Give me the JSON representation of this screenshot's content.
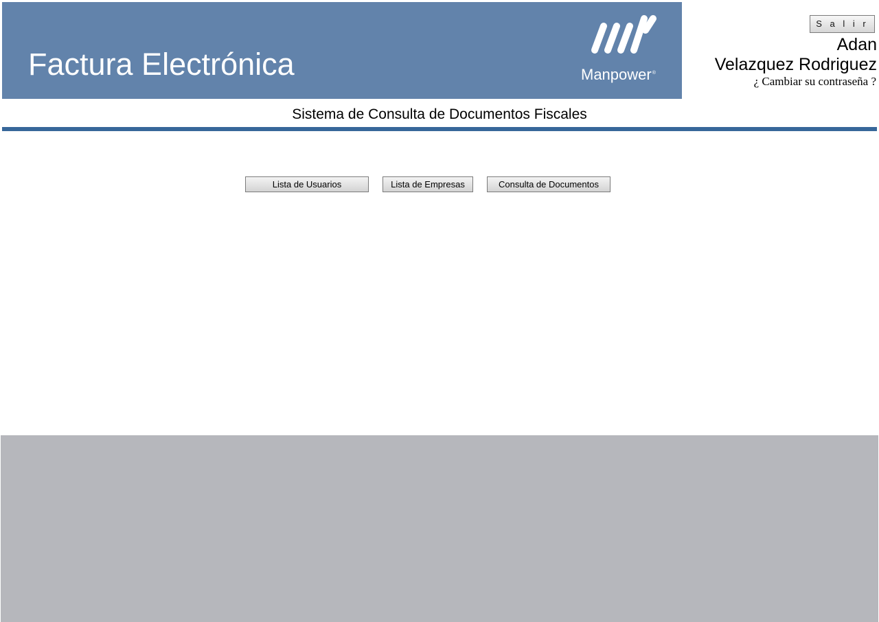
{
  "header": {
    "banner_title": "Factura Electrónica",
    "brand": "Manpower",
    "brand_mark": "®",
    "banner_color": "#6283ab"
  },
  "user": {
    "logout_label": "S a l i r",
    "first_name": "Adan",
    "last_name": "Velazquez Rodriguez",
    "change_password": "¿ Cambiar su contraseña ?"
  },
  "main": {
    "subtitle": "Sistema de Consulta de Documentos Fiscales",
    "divider_color": "#37679a",
    "buttons": [
      {
        "label": "Lista de Usuarios"
      },
      {
        "label": "Lista de Empresas"
      },
      {
        "label": "Consulta de Documentos"
      }
    ]
  },
  "footer": {
    "background_color": "#b6b7bc"
  }
}
